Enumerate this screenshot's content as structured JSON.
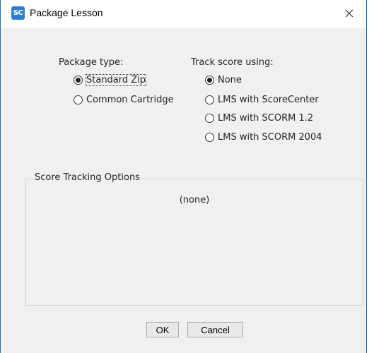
{
  "window": {
    "title": "Package Lesson",
    "icon_text": "SC",
    "icon": "sc-app-icon",
    "close_icon": "close-icon",
    "accent": "#1c6fb5"
  },
  "package_type": {
    "label": "Package type:",
    "options": [
      {
        "label": "Standard Zip",
        "selected": true
      },
      {
        "label": "Common Cartridge",
        "selected": false
      }
    ]
  },
  "track_score": {
    "label": "Track score using:",
    "options": [
      {
        "label": "None",
        "selected": true
      },
      {
        "label": "LMS with ScoreCenter",
        "selected": false
      },
      {
        "label": "LMS with SCORM 1.2",
        "selected": false
      },
      {
        "label": "LMS with SCORM 2004",
        "selected": false
      }
    ]
  },
  "score_tracking": {
    "legend": "Score Tracking Options",
    "empty_text": "(none)"
  },
  "buttons": {
    "ok": "OK",
    "cancel": "Cancel"
  }
}
